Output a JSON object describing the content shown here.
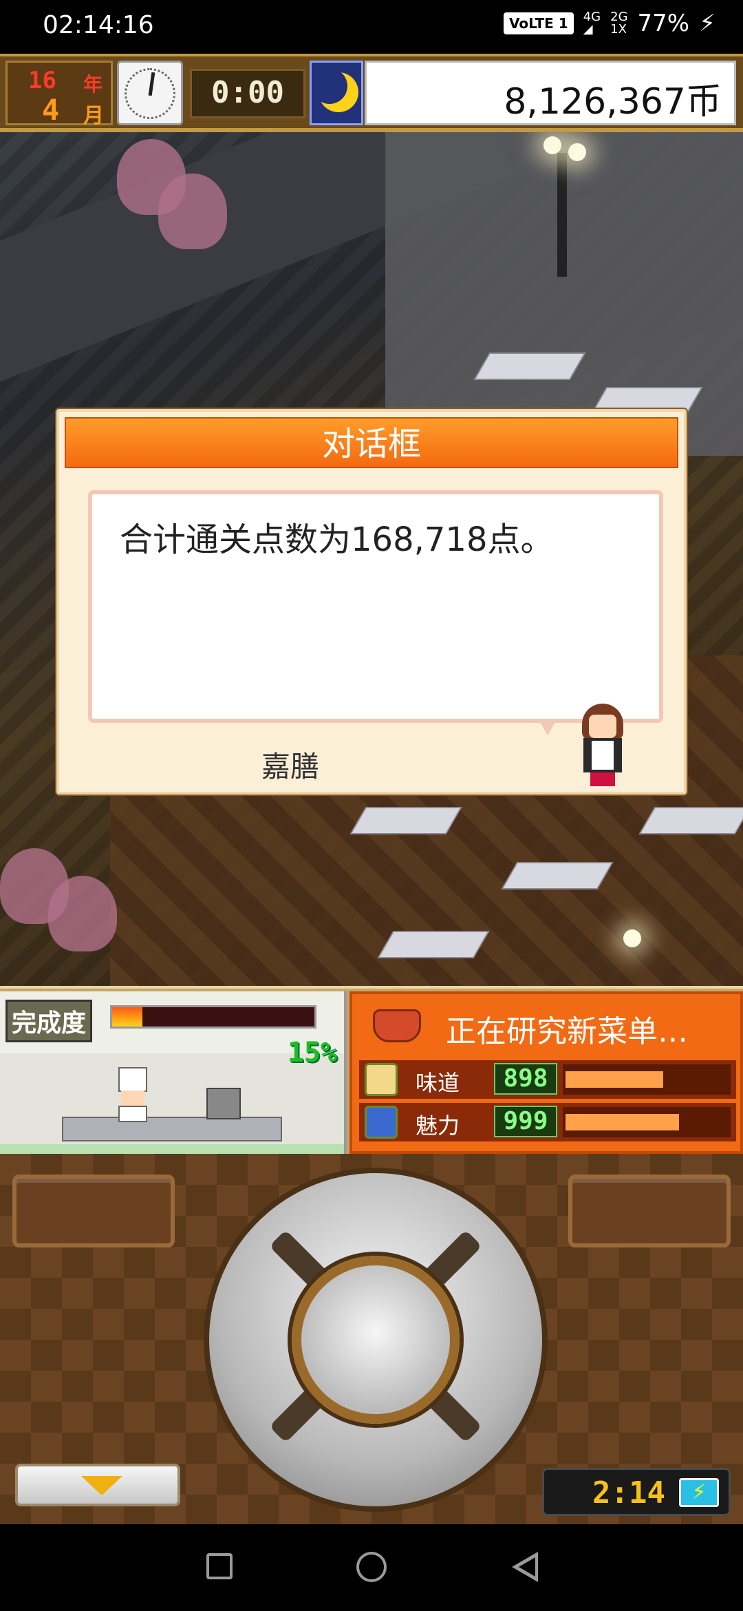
{
  "status_bar": {
    "time": "02:14:16",
    "volte": "VoLTE 1",
    "network_4g": "4G",
    "network_2g": "2G",
    "network_1x": "1X",
    "battery": "77%"
  },
  "hud": {
    "year_value": "16",
    "year_label": "年",
    "month_value": "4",
    "month_label": "月",
    "timer": "0:00",
    "money": "8,126,367币"
  },
  "dialog": {
    "title": "对话框",
    "message": "合计通关点数为168,718点。",
    "speaker": "嘉膳"
  },
  "progress": {
    "label": "完成度",
    "percent_text": "15%",
    "percent": 0.15
  },
  "research": {
    "title": "正在研究新菜单…",
    "stats": [
      {
        "name": "味道",
        "value": "898",
        "fill": 0.6
      },
      {
        "name": "魅力",
        "value": "999",
        "fill": 0.7
      }
    ]
  },
  "game_clock": {
    "time": "2:14"
  },
  "colors": {
    "dialog_header": "#f46a10",
    "research_bg": "#f26a14",
    "stat_green": "#88ff88"
  }
}
